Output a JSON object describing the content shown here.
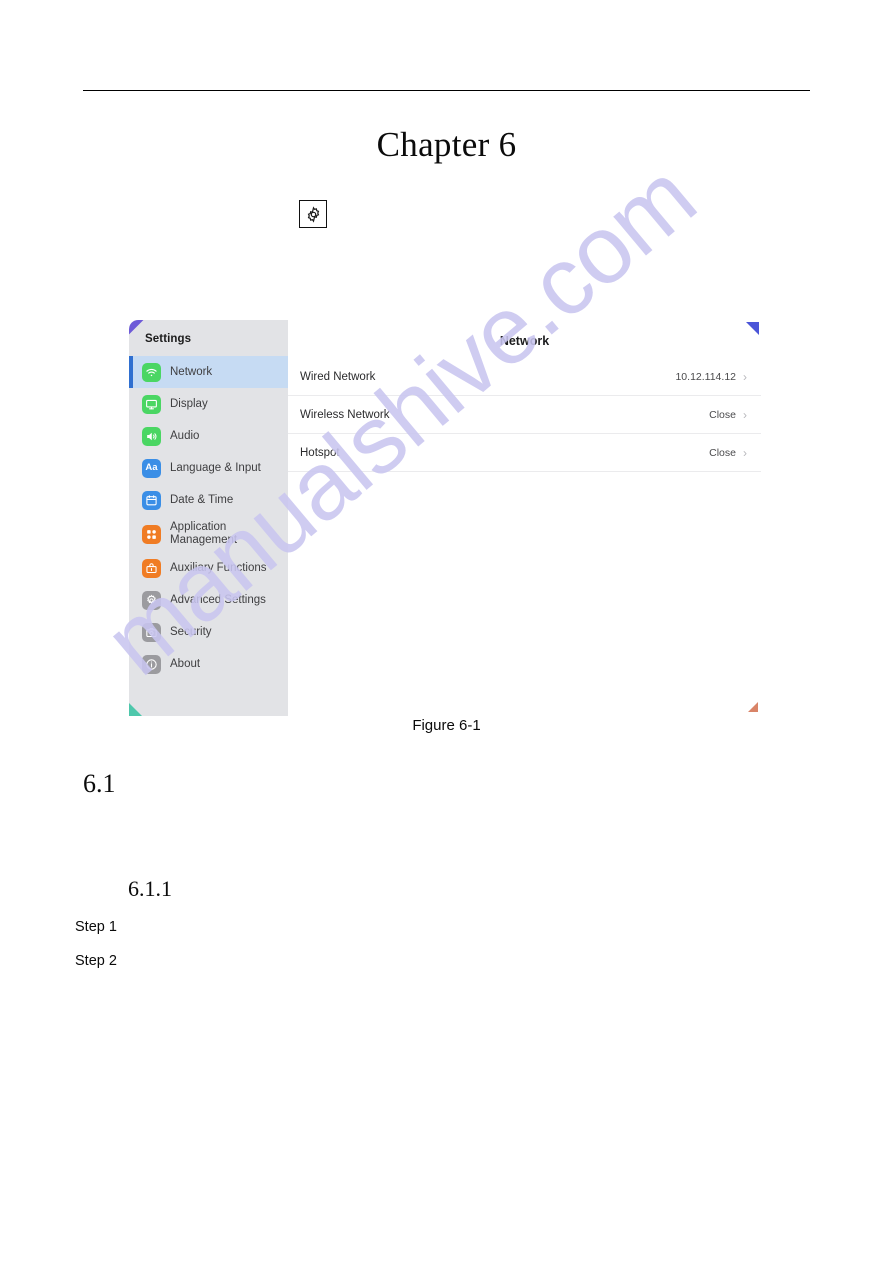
{
  "page": {
    "chapter_title": "Chapter 6",
    "chapter_icon": "gear-icon",
    "figure_caption": "Figure 6-1",
    "section_1": "6.1",
    "section_1_1": "6.1.1",
    "step_1": "Step 1",
    "step_2": "Step 2",
    "watermark": "manualshive.com"
  },
  "device": {
    "sidebar": {
      "title": "Settings",
      "items": [
        {
          "label": "Network",
          "icon": "wifi-icon",
          "color": "#4ad663",
          "active": true,
          "two_line": false
        },
        {
          "label": "Display",
          "icon": "monitor-icon",
          "color": "#4ad663",
          "active": false,
          "two_line": false
        },
        {
          "label": "Audio",
          "icon": "speaker-icon",
          "color": "#4ad663",
          "active": false,
          "two_line": false
        },
        {
          "label": "Language & Input",
          "icon": "aa-text-icon",
          "color": "#3a8ee6",
          "active": false,
          "two_line": false
        },
        {
          "label": "Date & Time",
          "icon": "calendar-icon",
          "color": "#3a8ee6",
          "active": false,
          "two_line": false
        },
        {
          "label": "Application\nManagement",
          "icon": "apps-grid-icon",
          "color": "#f07c24",
          "active": false,
          "two_line": true
        },
        {
          "label": "Auxiliary Functions",
          "icon": "toolbox-icon",
          "color": "#f07c24",
          "active": false,
          "two_line": false
        },
        {
          "label": "Advanced Settings",
          "icon": "gear-icon",
          "color": "#9b9b9f",
          "active": false,
          "two_line": false
        },
        {
          "label": "Security",
          "icon": "lock-camera-icon",
          "color": "#9b9b9f",
          "active": false,
          "two_line": false
        },
        {
          "label": "About",
          "icon": "info-icon",
          "color": "#9b9b9f",
          "active": false,
          "two_line": false
        }
      ]
    },
    "main": {
      "title": "Network",
      "rows": [
        {
          "label": "Wired Network",
          "value": "10.12.114.12"
        },
        {
          "label": "Wireless Network",
          "value": "Close"
        },
        {
          "label": "Hotspot",
          "value": "Close"
        }
      ],
      "chevron": "›"
    },
    "markers": {
      "top_left": "#6e5bd8",
      "top_right": "#4b55d8",
      "bottom_left": "#4ec7ab",
      "bottom_right": "#d98468"
    }
  }
}
